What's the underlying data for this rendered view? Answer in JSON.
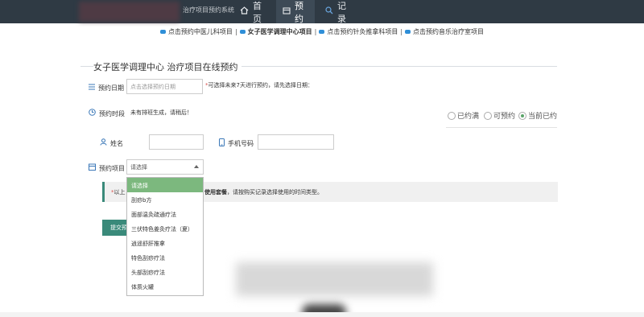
{
  "header": {
    "system_name": "治疗项目预约系统",
    "nav": [
      {
        "label": "首页",
        "icon": "home-icon"
      },
      {
        "label": "预约",
        "icon": "calendar-icon"
      },
      {
        "label": "记录",
        "icon": "search-icon"
      }
    ]
  },
  "sublinks": {
    "items": [
      "点击预约中医儿科项目",
      "女子医学调理中心项目",
      "点击预约针灸推拿科项目",
      "点击预约音乐治疗室项目"
    ],
    "separator": "|"
  },
  "form": {
    "title": "女子医学调理中心 治疗项目在线预约",
    "date_label": "预约日期",
    "date_placeholder": "点击选择预约日期",
    "date_hint_mark": "*",
    "date_hint": "可选择未来7天进行预约，请先选择日期：",
    "period_label": "预约时段",
    "period_text": "未有排班生成，请稍后！",
    "legend": [
      {
        "label": "已约满",
        "selected": false
      },
      {
        "label": "可预约",
        "selected": false
      },
      {
        "label": "当前已约",
        "selected": true
      }
    ],
    "name_label": "姓名",
    "phone_label": "手机号码",
    "item_label": "预约项目",
    "item_selected": "请选择",
    "notice_mark": "*",
    "notice_prefix": "以上",
    "notice_bold": "使用套餐",
    "notice_text": "，请按购买记录选择使用的时间类型。",
    "submit_label": "提交预约"
  },
  "dropdown": {
    "options": [
      "请选择",
      "刮痧b方",
      "面部温灸疏通疗法",
      "三伏特色姜灸疗法（夏）",
      "逍遥舒肝推拿",
      "特色刮痧疗法",
      "头部刮痧疗法",
      "体质火罐"
    ]
  },
  "colors": {
    "header_bg": "#2f3a44",
    "accent": "#3a8a7a",
    "selected_option": "#7cb87e"
  }
}
